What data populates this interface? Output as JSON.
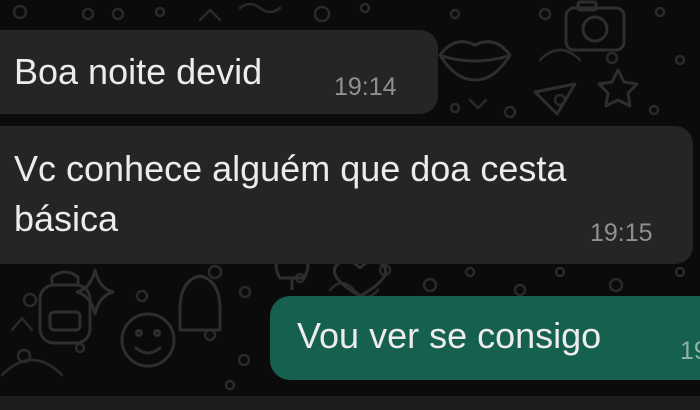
{
  "messages": [
    {
      "direction": "incoming",
      "lines": [
        "Boa noite devid"
      ],
      "time": "19:14"
    },
    {
      "direction": "incoming",
      "lines": [
        "Vc conhece alguém que doa cesta",
        "básica"
      ],
      "time": "19:15"
    },
    {
      "direction": "outgoing",
      "lines": [
        "Vou ver se consigo"
      ],
      "time": "19"
    }
  ],
  "colors": {
    "background": "#0b0b0b",
    "incoming_bubble": "#252525",
    "outgoing_bubble": "#15604f",
    "text": "#ececec",
    "timestamp": "#8f9092"
  },
  "wallpaper_icons": [
    "camera-doodle-icon",
    "lips-doodle-icon",
    "star-doodle-icon",
    "smiley-doodle-icon",
    "heart-doodle-icon",
    "tulip-doodle-icon",
    "paper-plane-doodle-icon",
    "backpack-doodle-icon"
  ]
}
